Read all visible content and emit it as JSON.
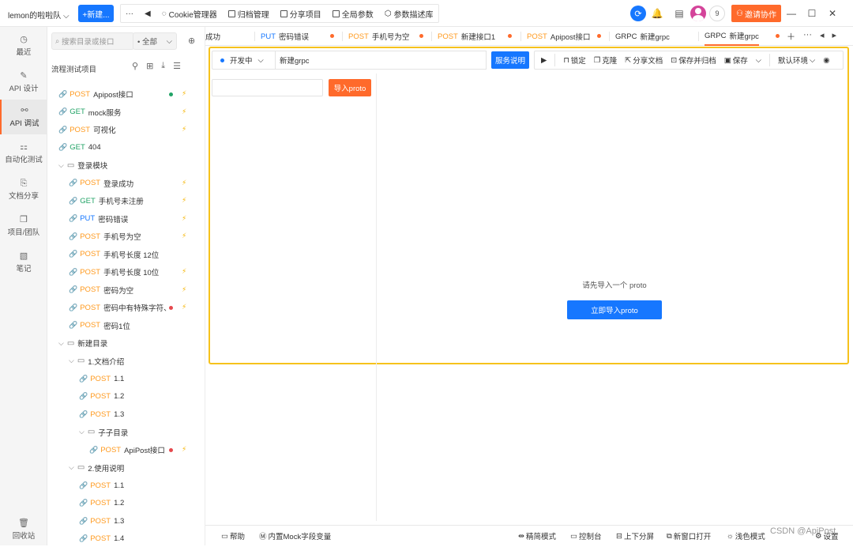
{
  "topbar": {
    "team": "lemon的啦啦队",
    "new_label": "+新建...",
    "more": "···",
    "tools": [
      "Cookie管理器",
      "归档管理",
      "分享项目",
      "全局参数",
      "参数描述库"
    ],
    "user_count": "9",
    "invite_label": "邀请协作"
  },
  "rail": [
    {
      "label": "最近",
      "icon": "clock-icon"
    },
    {
      "label": "API 设计",
      "icon": "design-icon"
    },
    {
      "label": "API 调试",
      "icon": "debug-icon"
    },
    {
      "label": "自动化测试",
      "icon": "automation-icon"
    },
    {
      "label": "文档分享",
      "icon": "doc-share-icon"
    },
    {
      "label": "项目/团队",
      "icon": "team-icon"
    },
    {
      "label": "笔记",
      "icon": "note-icon"
    },
    {
      "label": "回收站",
      "icon": "trash-icon"
    }
  ],
  "tree": {
    "search_placeholder": "搜索目录或接口",
    "filter": "全部",
    "project": "流程测试项目",
    "nodes": [
      {
        "method": "POST",
        "name": "Apipost接口"
      },
      {
        "method": "GET",
        "name": "mock服务"
      },
      {
        "method": "POST",
        "name": "可视化"
      },
      {
        "method": "GET",
        "name": "404"
      },
      {
        "folder": "登录模块"
      },
      {
        "method": "POST",
        "name": "登录成功"
      },
      {
        "method": "GET",
        "name": "手机号未注册"
      },
      {
        "method": "PUT",
        "name": "密码错误"
      },
      {
        "method": "POST",
        "name": "手机号为空"
      },
      {
        "method": "POST",
        "name": "手机号长度 12位"
      },
      {
        "method": "POST",
        "name": "手机号长度 10位"
      },
      {
        "method": "POST",
        "name": "密码为空"
      },
      {
        "method": "POST",
        "name": "密码中有特殊字符、"
      },
      {
        "method": "POST",
        "name": "密码1位"
      },
      {
        "folder": "新建目录"
      },
      {
        "folder": "1.文档介绍"
      },
      {
        "method": "POST",
        "name": "1.1"
      },
      {
        "method": "POST",
        "name": "1.2"
      },
      {
        "method": "POST",
        "name": "1.3"
      },
      {
        "folder": "子子目录"
      },
      {
        "method": "POST",
        "name": "ApiPost接口"
      },
      {
        "folder": "2.使用说明"
      },
      {
        "method": "POST",
        "name": "1.1"
      },
      {
        "method": "POST",
        "name": "1.2"
      },
      {
        "method": "POST",
        "name": "1.3"
      },
      {
        "method": "POST",
        "name": "1.4"
      }
    ]
  },
  "tabs": [
    {
      "method": "",
      "name": "成功"
    },
    {
      "method": "PUT",
      "name": "密码错误"
    },
    {
      "method": "POST",
      "name": "手机号为空"
    },
    {
      "method": "POST",
      "name": "新建接口1"
    },
    {
      "method": "POST",
      "name": "Apipost接口"
    },
    {
      "method": "GRPC",
      "name": "新建grpc"
    },
    {
      "method": "GRPC",
      "name": "新建grpc"
    }
  ],
  "request": {
    "env": "开发中",
    "name": "新建grpc",
    "service_doc": "服务说明",
    "actions": [
      "锁定",
      "克隆",
      "分享文档",
      "保存并归档",
      "保存"
    ],
    "default_env": "默认环境"
  },
  "proto": {
    "import_label": "导入proto",
    "empty_hint": "请先导入一个 proto",
    "import_now": "立即导入proto"
  },
  "bottom": {
    "help": "帮助",
    "mock_vars": "内置Mock字段变量",
    "simple_mode": "精简模式",
    "console": "控制台",
    "split": "上下分屏",
    "new_window": "新窗口打开",
    "light_mode": "浅色模式",
    "settings": "设置"
  },
  "watermark": "CSDN @ApiPost",
  "colors": {
    "accent": "#ff6a2b",
    "primary": "#1677ff",
    "frame": "#f6c21c"
  }
}
